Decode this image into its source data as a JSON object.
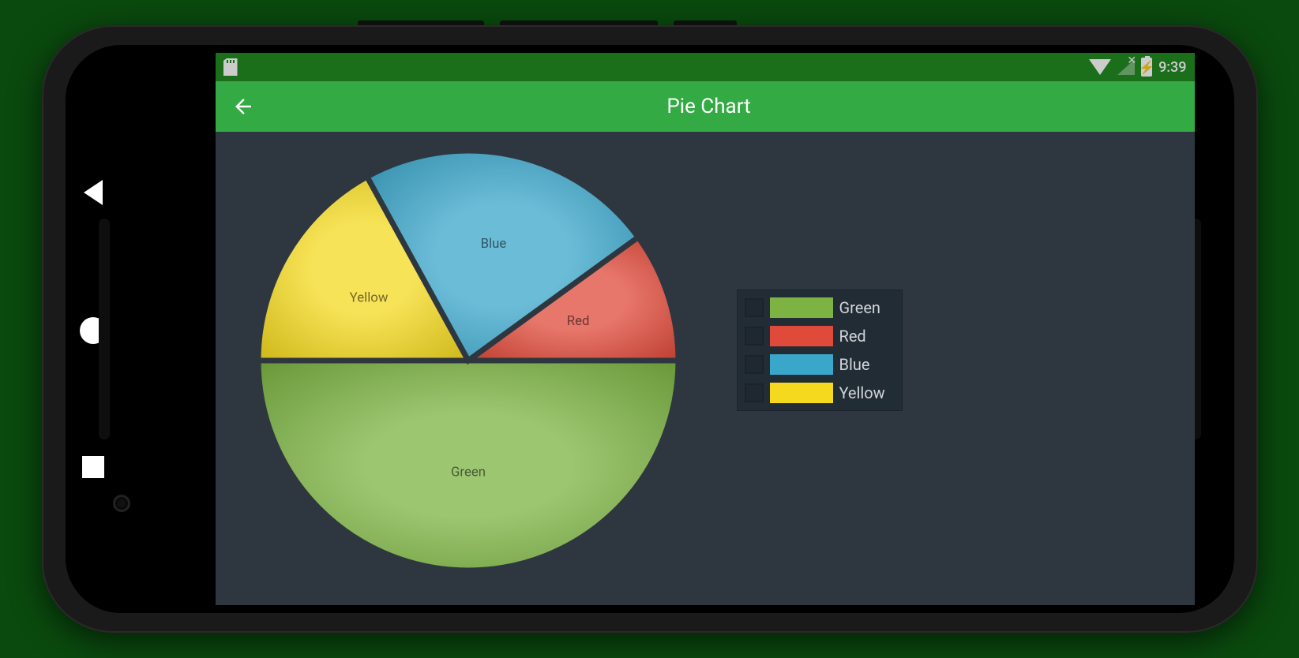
{
  "status": {
    "time": "9:39"
  },
  "appbar": {
    "title": "Pie Chart"
  },
  "legend": {
    "items": [
      {
        "label": "Green",
        "color": "#7cb342"
      },
      {
        "label": "Red",
        "color": "#e04a3a"
      },
      {
        "label": "Blue",
        "color": "#3aa6c9"
      },
      {
        "label": "Yellow",
        "color": "#f4d91f"
      }
    ]
  },
  "chart_data": {
    "type": "pie",
    "title": "Pie Chart",
    "slices": [
      {
        "name": "Green",
        "value": 50,
        "color": "#7cb342"
      },
      {
        "name": "Yellow",
        "value": 17,
        "color": "#f4d91f"
      },
      {
        "name": "Blue",
        "value": 23,
        "color": "#3aa6c9"
      },
      {
        "name": "Red",
        "value": 10,
        "color": "#e04a3a"
      }
    ],
    "slice_labels": {
      "green": "Green",
      "yellow": "Yellow",
      "blue": "Blue",
      "red": "Red"
    }
  }
}
